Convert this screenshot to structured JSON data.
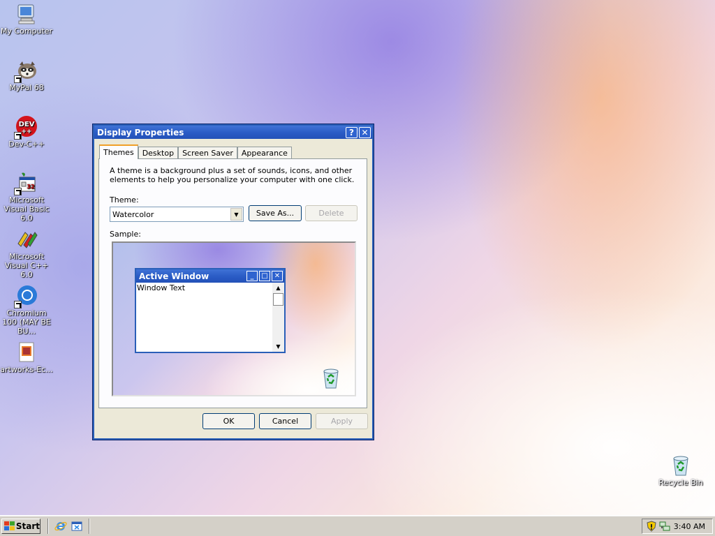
{
  "desktop": {
    "icons": [
      {
        "label": "My Computer",
        "icon": "my-computer-icon"
      },
      {
        "label": "MyPal 68",
        "icon": "mypal-raccoon-icon"
      },
      {
        "label": "Dev-C++",
        "icon": "devcpp-icon",
        "badge": "DEV",
        "badge_sub": "++"
      },
      {
        "label": "Microsoft Visual Basic 6.0",
        "icon": "vb6-icon"
      },
      {
        "label": "Microsoft Visual C++ 6.0",
        "icon": "vc6-icon"
      },
      {
        "label": "Chromium 100 (MAY BE BU...",
        "icon": "chromium-icon"
      },
      {
        "label": "artworks-Ec...",
        "icon": "image-file-icon"
      },
      {
        "label": "Recycle Bin",
        "icon": "recycle-bin-icon"
      }
    ]
  },
  "dialog": {
    "title": "Display Properties",
    "help_glyph": "?",
    "close_glyph": "✕",
    "tabs": [
      "Themes",
      "Desktop",
      "Screen Saver",
      "Appearance"
    ],
    "active_tab": "Themes",
    "description": "A theme is a background plus a set of sounds, icons, and other elements to help you personalize your computer with one click.",
    "theme_label": "Theme:",
    "theme_value": "Watercolor",
    "save_as_label": "Save As...",
    "delete_label": "Delete",
    "sample_label": "Sample:",
    "sample": {
      "window_title": "Active Window",
      "window_text": "Window Text",
      "min_glyph": "_",
      "max_glyph": "□",
      "close_glyph": "✕"
    },
    "ok_label": "OK",
    "cancel_label": "Cancel",
    "apply_label": "Apply"
  },
  "taskbar": {
    "start_label": "Start",
    "quick_launch": [
      "internet-explorer-icon",
      "show-desktop-icon"
    ],
    "tray_icons": [
      "security-shield-icon",
      "network-icon"
    ],
    "clock": "3:40 AM"
  },
  "colors": {
    "title_blue": "#2a5bc5",
    "dialog_face": "#ece9d8",
    "tab_highlight": "#f0a028"
  }
}
